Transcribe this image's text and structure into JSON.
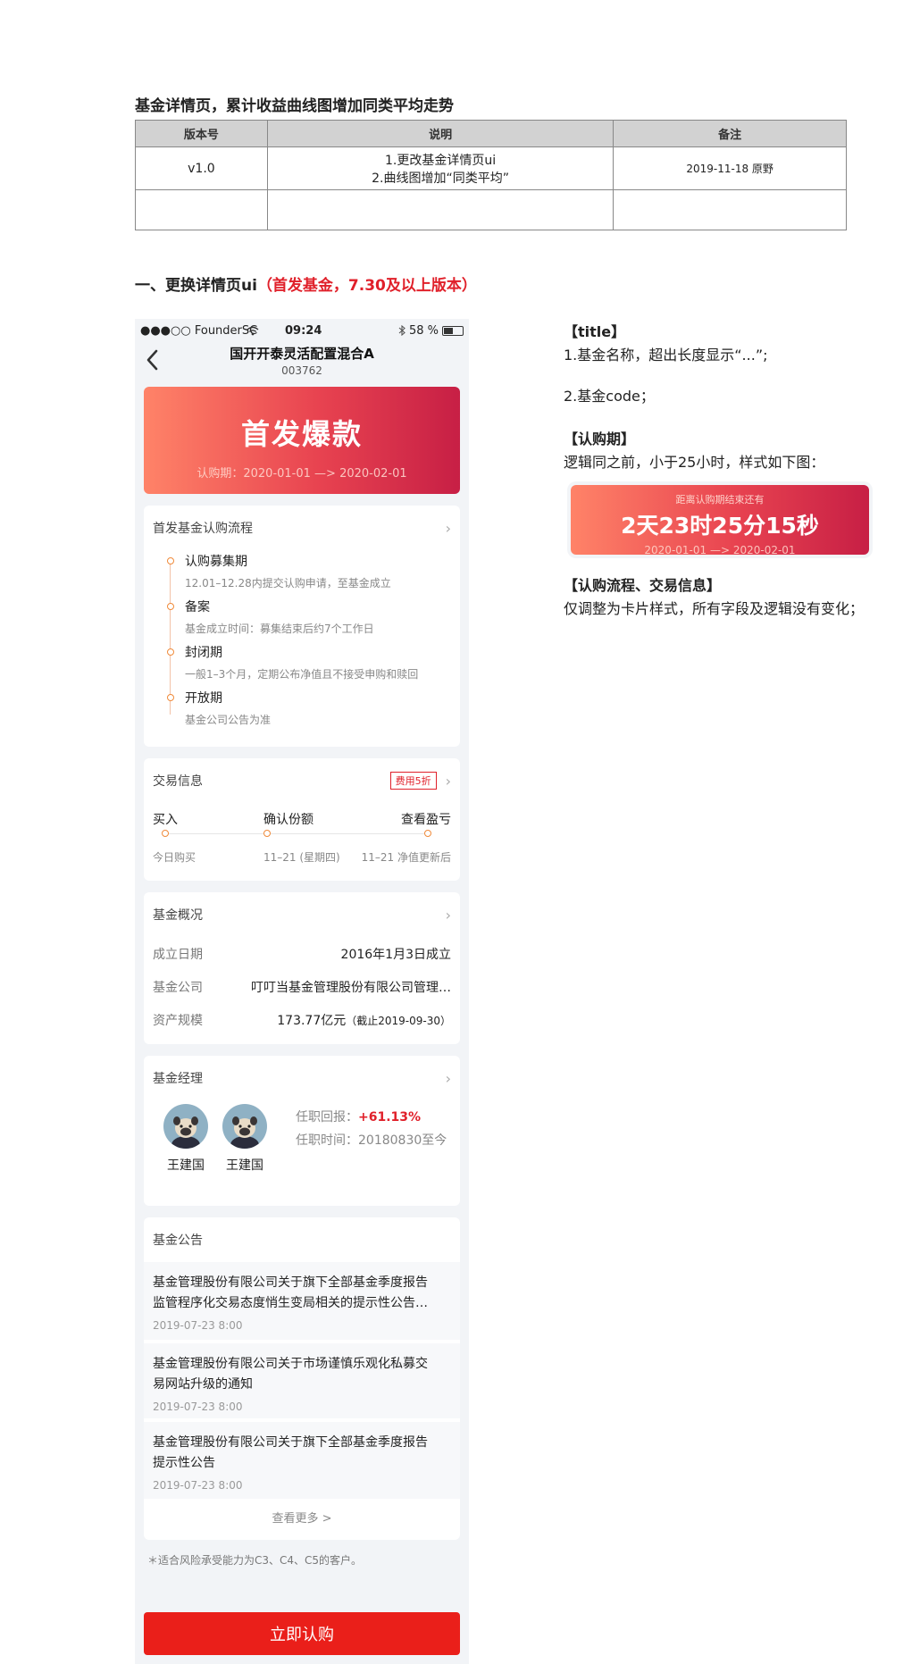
{
  "doc": {
    "title": "基金详情页，累计收益曲线图增加同类平均走势",
    "table": {
      "headers": [
        "版本号",
        "说明",
        "备注"
      ],
      "rows": [
        {
          "version": "v1.0",
          "desc_line1": "1.更改基金详情页ui",
          "desc_line2": "2.曲线图增加“同类平均”",
          "note": "2019-11-18    原野"
        }
      ]
    },
    "section_title": "一、更换详情页ui",
    "section_title_red": "（首发基金，7.30及以上版本）"
  },
  "phone": {
    "status": {
      "carrier": "●●●○○ FounderSC",
      "time": "09:24",
      "battery": "58 %"
    },
    "nav": {
      "back": "‹",
      "title": "国开开泰灵活配置混合A",
      "code": "003762"
    },
    "hero": {
      "title": "首发爆款",
      "period": "认购期：2020-01-01 —> 2020-02-01"
    },
    "process": {
      "title": "首发基金认购流程",
      "steps": [
        {
          "title": "认购募集期",
          "desc": "12.01–12.28内提交认购申请，至基金成立"
        },
        {
          "title": "备案",
          "desc": "基金成立时间：募集结束后约7个工作日"
        },
        {
          "title": "封闭期",
          "desc": "一般1–3个月，定期公布净值且不接受申购和赎回"
        },
        {
          "title": "开放期",
          "desc": "基金公司公告为准"
        }
      ]
    },
    "trade": {
      "title": "交易信息",
      "fee": "费用5折",
      "labels": [
        "买入",
        "确认份额",
        "查看盈亏"
      ],
      "subs": [
        "今日购买",
        "11–21 (星期四)",
        "11–21 净值更新后"
      ]
    },
    "overview": {
      "title": "基金概况",
      "rows": [
        {
          "k": "成立日期",
          "v": "2016年1月3日成立",
          "note": ""
        },
        {
          "k": "基金公司",
          "v": "叮叮当基金管理股份有限公司管理…",
          "note": ""
        },
        {
          "k": "资产规模",
          "v": "173.77亿元",
          "note": "（截止2019-09-30）"
        }
      ]
    },
    "manager": {
      "title": "基金经理",
      "names": [
        "王建国",
        "王建国"
      ],
      "return_label": "任职回报：",
      "return_value": "+61.13%",
      "tenure": "任职时间：20180830至今"
    },
    "notices": {
      "title": "基金公告",
      "items": [
        {
          "line1": "基金管理股份有限公司关于旗下全部基金季度报告",
          "line2": "监管程序化交易态度悄生变局相关的提示性公告…",
          "date": "2019-07-23  8:00"
        },
        {
          "line1": "基金管理股份有限公司关于市场谨慎乐观化私募交",
          "line2": "易网站升级的通知",
          "date": "2019-07-23  8:00"
        },
        {
          "line1": "基金管理股份有限公司关于旗下全部基金季度报告",
          "line2": "提示性公告",
          "date": "2019-07-23  8:00"
        }
      ],
      "more": "查看更多 >"
    },
    "risk": "＊适合风险承受能力为C3、C4、C5的客户。",
    "buy": "立即认购"
  },
  "notes": {
    "title_head": "【title】",
    "title_1": "1.基金名称，超出长度显示“...”;",
    "title_2": "2.基金code；",
    "period_head": "【认购期】",
    "period_desc": "逻辑同之前，小于25小时，样式如下图：",
    "countdown": {
      "label": "距离认购期结束还有",
      "time": "2天23时25分15秒",
      "range": "2020-01-01 —> 2020-02-01"
    },
    "flow_head": "【认购流程、交易信息】",
    "flow_desc": "仅调整为卡片样式，所有字段及逻辑没有变化；"
  },
  "colors": {
    "accent_red": "#e0202a",
    "button_red": "#ea1f1a",
    "hero_start": "#ff8368",
    "hero_end": "#c71f45",
    "step_orange": "#f08a3a"
  }
}
